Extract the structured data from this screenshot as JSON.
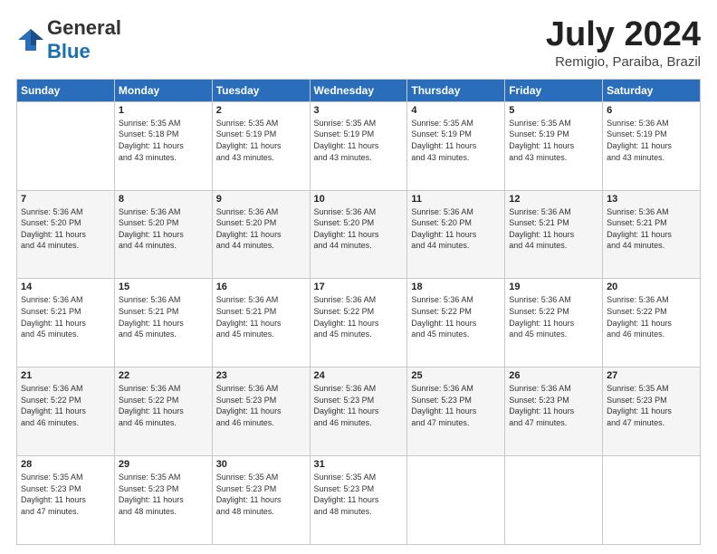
{
  "header": {
    "logo_general": "General",
    "logo_blue": "Blue",
    "month_title": "July 2024",
    "subtitle": "Remigio, Paraiba, Brazil"
  },
  "weekdays": [
    "Sunday",
    "Monday",
    "Tuesday",
    "Wednesday",
    "Thursday",
    "Friday",
    "Saturday"
  ],
  "weeks": [
    [
      {
        "day": "",
        "info": ""
      },
      {
        "day": "1",
        "info": "Sunrise: 5:35 AM\nSunset: 5:18 PM\nDaylight: 11 hours\nand 43 minutes."
      },
      {
        "day": "2",
        "info": "Sunrise: 5:35 AM\nSunset: 5:19 PM\nDaylight: 11 hours\nand 43 minutes."
      },
      {
        "day": "3",
        "info": "Sunrise: 5:35 AM\nSunset: 5:19 PM\nDaylight: 11 hours\nand 43 minutes."
      },
      {
        "day": "4",
        "info": "Sunrise: 5:35 AM\nSunset: 5:19 PM\nDaylight: 11 hours\nand 43 minutes."
      },
      {
        "day": "5",
        "info": "Sunrise: 5:35 AM\nSunset: 5:19 PM\nDaylight: 11 hours\nand 43 minutes."
      },
      {
        "day": "6",
        "info": "Sunrise: 5:36 AM\nSunset: 5:19 PM\nDaylight: 11 hours\nand 43 minutes."
      }
    ],
    [
      {
        "day": "7",
        "info": "Sunrise: 5:36 AM\nSunset: 5:20 PM\nDaylight: 11 hours\nand 44 minutes."
      },
      {
        "day": "8",
        "info": "Sunrise: 5:36 AM\nSunset: 5:20 PM\nDaylight: 11 hours\nand 44 minutes."
      },
      {
        "day": "9",
        "info": "Sunrise: 5:36 AM\nSunset: 5:20 PM\nDaylight: 11 hours\nand 44 minutes."
      },
      {
        "day": "10",
        "info": "Sunrise: 5:36 AM\nSunset: 5:20 PM\nDaylight: 11 hours\nand 44 minutes."
      },
      {
        "day": "11",
        "info": "Sunrise: 5:36 AM\nSunset: 5:20 PM\nDaylight: 11 hours\nand 44 minutes."
      },
      {
        "day": "12",
        "info": "Sunrise: 5:36 AM\nSunset: 5:21 PM\nDaylight: 11 hours\nand 44 minutes."
      },
      {
        "day": "13",
        "info": "Sunrise: 5:36 AM\nSunset: 5:21 PM\nDaylight: 11 hours\nand 44 minutes."
      }
    ],
    [
      {
        "day": "14",
        "info": "Sunrise: 5:36 AM\nSunset: 5:21 PM\nDaylight: 11 hours\nand 45 minutes."
      },
      {
        "day": "15",
        "info": "Sunrise: 5:36 AM\nSunset: 5:21 PM\nDaylight: 11 hours\nand 45 minutes."
      },
      {
        "day": "16",
        "info": "Sunrise: 5:36 AM\nSunset: 5:21 PM\nDaylight: 11 hours\nand 45 minutes."
      },
      {
        "day": "17",
        "info": "Sunrise: 5:36 AM\nSunset: 5:22 PM\nDaylight: 11 hours\nand 45 minutes."
      },
      {
        "day": "18",
        "info": "Sunrise: 5:36 AM\nSunset: 5:22 PM\nDaylight: 11 hours\nand 45 minutes."
      },
      {
        "day": "19",
        "info": "Sunrise: 5:36 AM\nSunset: 5:22 PM\nDaylight: 11 hours\nand 45 minutes."
      },
      {
        "day": "20",
        "info": "Sunrise: 5:36 AM\nSunset: 5:22 PM\nDaylight: 11 hours\nand 46 minutes."
      }
    ],
    [
      {
        "day": "21",
        "info": "Sunrise: 5:36 AM\nSunset: 5:22 PM\nDaylight: 11 hours\nand 46 minutes."
      },
      {
        "day": "22",
        "info": "Sunrise: 5:36 AM\nSunset: 5:22 PM\nDaylight: 11 hours\nand 46 minutes."
      },
      {
        "day": "23",
        "info": "Sunrise: 5:36 AM\nSunset: 5:23 PM\nDaylight: 11 hours\nand 46 minutes."
      },
      {
        "day": "24",
        "info": "Sunrise: 5:36 AM\nSunset: 5:23 PM\nDaylight: 11 hours\nand 46 minutes."
      },
      {
        "day": "25",
        "info": "Sunrise: 5:36 AM\nSunset: 5:23 PM\nDaylight: 11 hours\nand 47 minutes."
      },
      {
        "day": "26",
        "info": "Sunrise: 5:36 AM\nSunset: 5:23 PM\nDaylight: 11 hours\nand 47 minutes."
      },
      {
        "day": "27",
        "info": "Sunrise: 5:35 AM\nSunset: 5:23 PM\nDaylight: 11 hours\nand 47 minutes."
      }
    ],
    [
      {
        "day": "28",
        "info": "Sunrise: 5:35 AM\nSunset: 5:23 PM\nDaylight: 11 hours\nand 47 minutes."
      },
      {
        "day": "29",
        "info": "Sunrise: 5:35 AM\nSunset: 5:23 PM\nDaylight: 11 hours\nand 48 minutes."
      },
      {
        "day": "30",
        "info": "Sunrise: 5:35 AM\nSunset: 5:23 PM\nDaylight: 11 hours\nand 48 minutes."
      },
      {
        "day": "31",
        "info": "Sunrise: 5:35 AM\nSunset: 5:23 PM\nDaylight: 11 hours\nand 48 minutes."
      },
      {
        "day": "",
        "info": ""
      },
      {
        "day": "",
        "info": ""
      },
      {
        "day": "",
        "info": ""
      }
    ]
  ]
}
